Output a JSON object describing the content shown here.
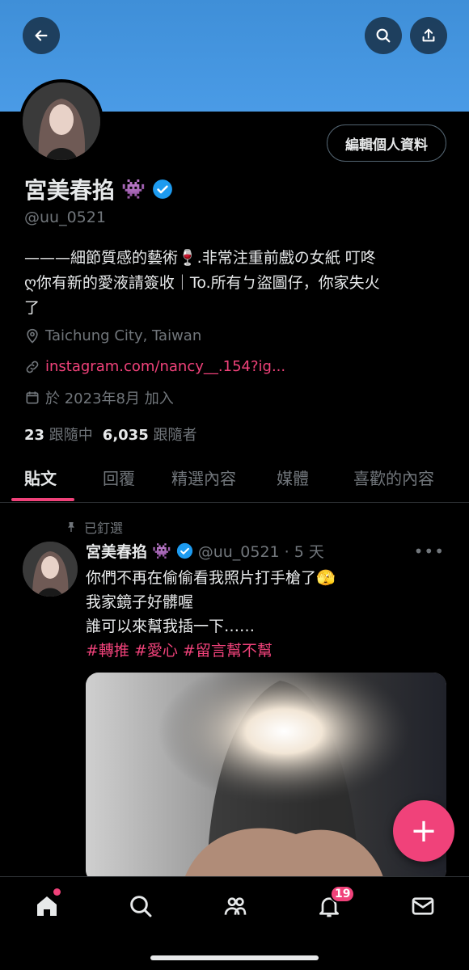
{
  "header": {
    "back_icon": "arrow-left-icon",
    "search_icon": "search-icon",
    "share_icon": "share-icon"
  },
  "profile": {
    "display_name": "宮美春掐",
    "badge_emoji": "👾",
    "handle": "@uu_0521",
    "edit_label": "編輯個人資料",
    "bio_line1": "———細節質感的藝術🍷.非常注重前戲の女紙 叮咚",
    "bio_line2": "ღ你有新的愛液請簽收｜To.所有ㄅ盜圖仔，你家失火",
    "bio_line3": "了",
    "location": "Taichung City, Taiwan",
    "website": "instagram.com/nancy__.154?ig...",
    "joined": "於 2023年8月 加入",
    "following_count": "23",
    "following_label": "跟隨中",
    "followers_count": "6,035",
    "followers_label": "跟隨者"
  },
  "tabs": [
    {
      "label": "貼文",
      "active": true
    },
    {
      "label": "回覆",
      "active": false
    },
    {
      "label": "精選內容",
      "active": false
    },
    {
      "label": "媒體",
      "active": false
    },
    {
      "label": "喜歡的內容",
      "active": false
    }
  ],
  "tweet": {
    "pinned_label": "已釘選",
    "name": "宮美春掐",
    "badge_emoji": "👾",
    "handle_time": "@uu_0521 · 5 天",
    "line1": "你們不再在偷偷看我照片打手槍了🫣",
    "line2": "我家鏡子好髒喔",
    "line3": "誰可以來幫我插一下……",
    "hashtags": "#轉推 #愛心 #留言幫不幫"
  },
  "fab_label": "+",
  "bottom_nav": {
    "items": [
      "home-icon",
      "search-icon",
      "communities-icon",
      "notifications-icon",
      "messages-icon"
    ],
    "notification_badge": "19"
  },
  "colors": {
    "accent": "#f0427a",
    "verified": "#1d9bf0",
    "banner": "#4a9be6"
  }
}
